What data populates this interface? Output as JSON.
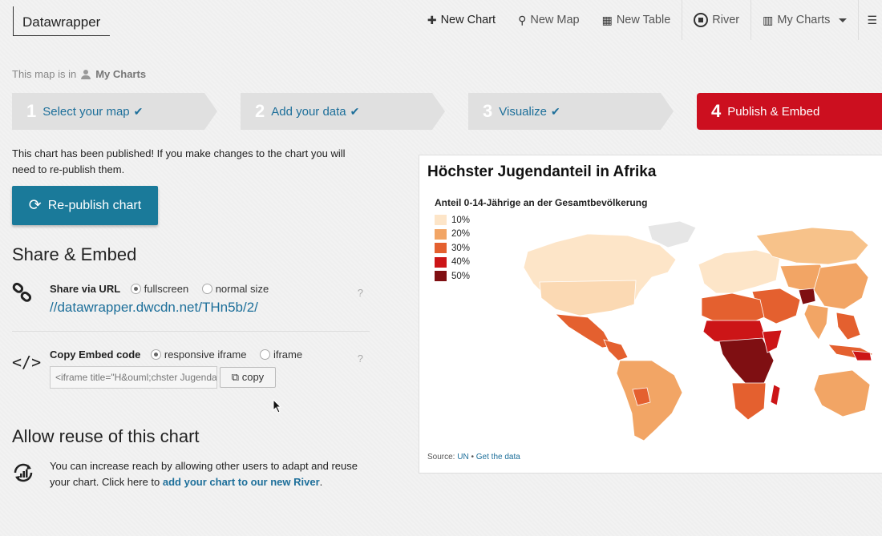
{
  "app": {
    "logo": "Datawrapper"
  },
  "nav": {
    "new_chart": "New Chart",
    "new_map": "New Map",
    "new_table": "New Table",
    "river": "River",
    "my_charts": "My Charts"
  },
  "breadcrumb": {
    "prefix": "This map is in",
    "folder": "My Charts"
  },
  "steps": [
    {
      "num": "1",
      "label": "Select your map",
      "done": true
    },
    {
      "num": "2",
      "label": "Add your data",
      "done": true
    },
    {
      "num": "3",
      "label": "Visualize",
      "done": true
    },
    {
      "num": "4",
      "label": "Publish & Embed",
      "active": true
    }
  ],
  "publish": {
    "message": "This chart has been published! If you make changes to the chart you will need to re-publish them.",
    "republish_label": "Re-publish chart"
  },
  "share": {
    "heading": "Share & Embed",
    "url_title": "Share via URL",
    "opt_fullscreen": "fullscreen",
    "opt_normal": "normal size",
    "url": "//datawrapper.dwcdn.net/THn5b/2/",
    "help": "?",
    "embed_title": "Copy Embed code",
    "opt_responsive": "responsive iframe",
    "opt_iframe": "iframe",
    "embed_code": "<iframe title=\"H&ouml;chster Jugendanteil in Afrika\"",
    "copy_label": "copy"
  },
  "reuse": {
    "heading": "Allow reuse of this chart",
    "text": "You can increase reach by allowing other users to adapt and reuse your chart. Click here to ",
    "link": "add your chart to our new River",
    "suffix": "."
  },
  "chart": {
    "title": "Höchster Jugendanteil in Afrika",
    "legend_title": "Anteil 0-14-Jährige an der Gesamtbevölkerung",
    "legend": [
      {
        "label": "10%",
        "color": "#fde5c8"
      },
      {
        "label": "20%",
        "color": "#f2a565"
      },
      {
        "label": "30%",
        "color": "#e4602f"
      },
      {
        "label": "40%",
        "color": "#cc1517"
      },
      {
        "label": "50%",
        "color": "#7f0f12"
      }
    ],
    "source_prefix": "Source: ",
    "source_link": "UN",
    "source_sep": " • ",
    "get_data": "Get the data"
  },
  "colors": {
    "accent": "#cc0f1f",
    "link": "#1d6f9a",
    "button": "#1a7a9a"
  }
}
